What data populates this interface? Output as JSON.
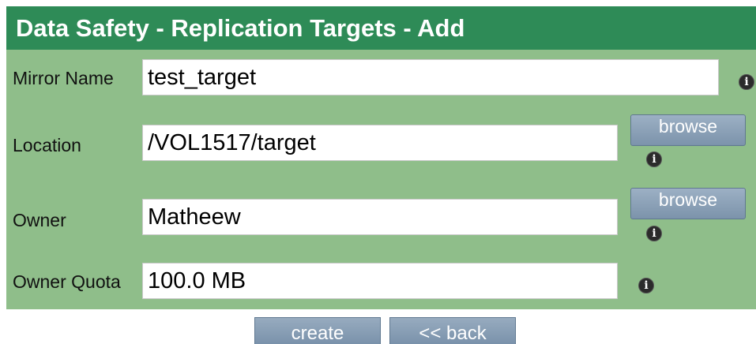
{
  "page": {
    "title": "Data Safety - Replication Targets - Add"
  },
  "form": {
    "mirror_name": {
      "label": "Mirror Name",
      "value": "test_target"
    },
    "location": {
      "label": "Location",
      "value": "/VOL1517/target",
      "browse_label": "browse"
    },
    "owner": {
      "label": "Owner",
      "value": "Matheew",
      "browse_label": "browse"
    },
    "owner_quota": {
      "label": "Owner Quota",
      "value": "100.0 MB"
    }
  },
  "icons": {
    "info": "info-icon",
    "info_glyph": "i"
  },
  "actions": {
    "create_label": "create",
    "back_label": "<< back"
  },
  "colors": {
    "header_bg": "#2e8b57",
    "panel_bg": "#8fbe8a",
    "button_bg": "#8aa2bb"
  }
}
